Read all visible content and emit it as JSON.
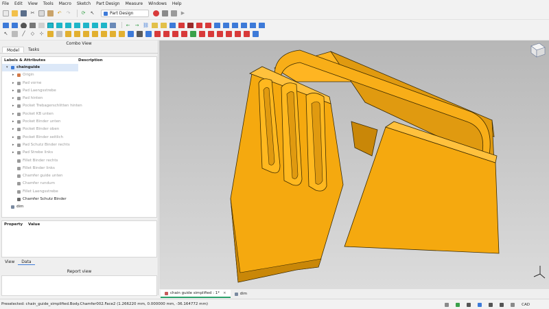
{
  "menu": [
    "File",
    "Edit",
    "View",
    "Tools",
    "Macro",
    "Sketch",
    "Part Design",
    "Measure",
    "Windows",
    "Help"
  ],
  "workbench": "Part Design",
  "combo_view": {
    "title": "Combo View",
    "tabs": [
      "Model",
      "Tasks"
    ],
    "tree_headers": [
      "Labels & Attributes",
      "Description"
    ],
    "tree": [
      {
        "label": "chainguide",
        "level": 0,
        "arrow": "▾",
        "icon_color": "#3d7ad8",
        "style": "root"
      },
      {
        "label": "Origin",
        "level": 1,
        "arrow": "▸",
        "icon_color": "#d27a4a",
        "style": "dim"
      },
      {
        "label": "Pad vorne",
        "level": 1,
        "arrow": "▸",
        "icon_color": "#9a9a9a",
        "style": "dim"
      },
      {
        "label": "Pad Laengsstrebe",
        "level": 1,
        "arrow": "▸",
        "icon_color": "#9a9a9a",
        "style": "dim"
      },
      {
        "label": "Pad hinten",
        "level": 1,
        "arrow": "▸",
        "icon_color": "#9a9a9a",
        "style": "dim"
      },
      {
        "label": "Pocket Trebagerschlitten hinten",
        "level": 1,
        "arrow": "▸",
        "icon_color": "#9a9a9a",
        "style": "dim"
      },
      {
        "label": "Pocket KB unten",
        "level": 1,
        "arrow": "▸",
        "icon_color": "#9a9a9a",
        "style": "dim"
      },
      {
        "label": "Pocket Binder unten",
        "level": 1,
        "arrow": "▸",
        "icon_color": "#9a9a9a",
        "style": "dim"
      },
      {
        "label": "Pocket Binder oben",
        "level": 1,
        "arrow": "▸",
        "icon_color": "#9a9a9a",
        "style": "dim"
      },
      {
        "label": "Pocket Binder seitlich",
        "level": 1,
        "arrow": "▸",
        "icon_color": "#9a9a9a",
        "style": "dim"
      },
      {
        "label": "Pad Schutz Binder rechts",
        "level": 1,
        "arrow": "▸",
        "icon_color": "#9a9a9a",
        "style": "dim"
      },
      {
        "label": "Pad Strebe links",
        "level": 1,
        "arrow": "▸",
        "icon_color": "#9a9a9a",
        "style": "dim"
      },
      {
        "label": "Fillet Binder rechts",
        "level": 1,
        "arrow": "",
        "icon_color": "#9a9a9a",
        "style": "dim"
      },
      {
        "label": "Fillet Binder links",
        "level": 1,
        "arrow": "",
        "icon_color": "#9a9a9a",
        "style": "dim"
      },
      {
        "label": "Chamfer guide unten",
        "level": 1,
        "arrow": "",
        "icon_color": "#9a9a9a",
        "style": "dim"
      },
      {
        "label": "Chamfer rundum",
        "level": 1,
        "arrow": "",
        "icon_color": "#9a9a9a",
        "style": "dim"
      },
      {
        "label": "Fillet Laengsstrebe",
        "level": 1,
        "arrow": "",
        "icon_color": "#9a9a9a",
        "style": "dim"
      },
      {
        "label": "Chamfer Schutz Binder",
        "level": 1,
        "arrow": "",
        "icon_color": "#6a6a6a",
        "style": "normal"
      },
      {
        "label": "dim",
        "level": 0,
        "arrow": "",
        "icon_color": "#7a8aa0",
        "style": "normal"
      }
    ],
    "property_headers": [
      "Property",
      "Value"
    ],
    "view_tabs": [
      "View",
      "Data"
    ]
  },
  "report_view": {
    "title": "Report view"
  },
  "document_tabs": [
    {
      "label": "chain guide simplified : 1*",
      "active": true,
      "close": "×"
    },
    {
      "label": "dim",
      "active": false,
      "close": ""
    }
  ],
  "status": {
    "text": "Preselected: chain_guide_simplified.Body.Chamfer002.Face2 (1.266220 mm, 0.000000 mm, -36.164772 mm)",
    "navigation": "CAD"
  },
  "colors": {
    "part": "#f5a90f",
    "part_dark": "#c98708",
    "part_light": "#ffc13d",
    "accent": "#3d7ad8"
  }
}
